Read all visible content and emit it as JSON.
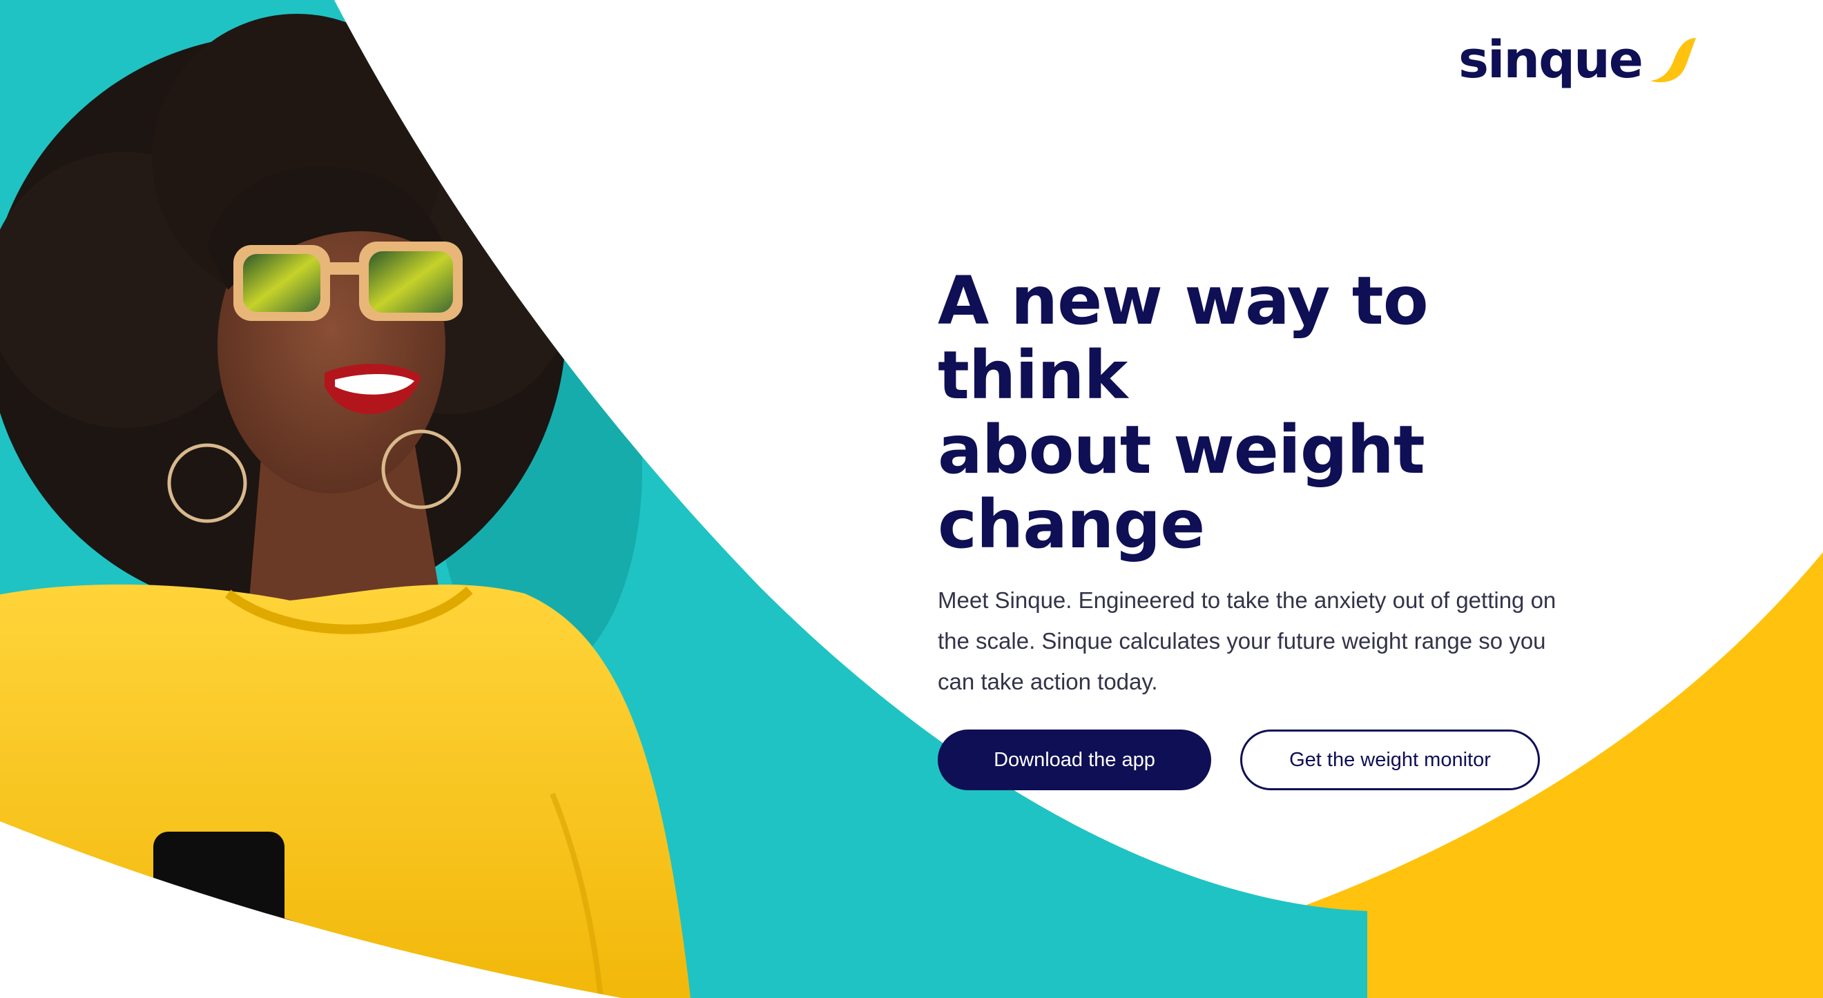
{
  "brand": {
    "name": "sinque",
    "navy": "#0f0f55",
    "teal": "#1fc3c3",
    "yellow": "#ffc20e"
  },
  "hero": {
    "headline_line1": "A new way to think",
    "headline_line2": "about weight change",
    "body": "Meet Sinque. Engineered to take the anxiety out of getting on the scale. Sinque calculates your future weight range so you can take action today.",
    "primary_cta": "Download the app",
    "secondary_cta": "Get the weight monitor"
  },
  "illustration": {
    "subject": "smiling woman with sunglasses, yellow sweater, holding a phone",
    "icons": [
      "sinque-swoosh-icon"
    ]
  }
}
